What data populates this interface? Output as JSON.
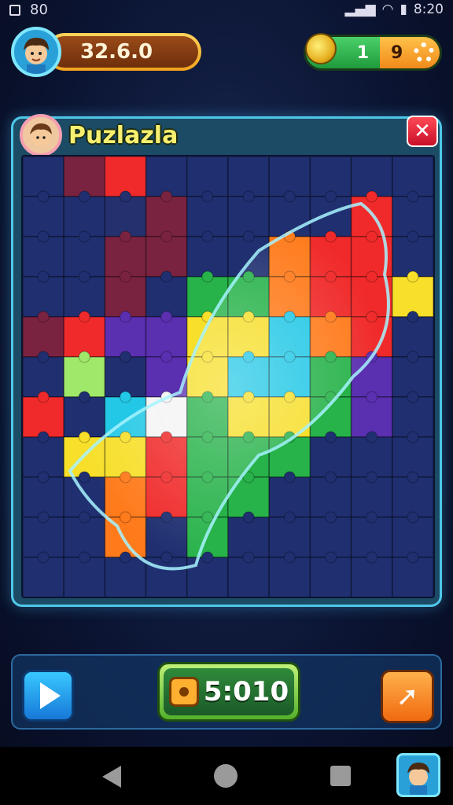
{
  "status_bar": {
    "left_text": "80",
    "time": "8:20"
  },
  "hud": {
    "score": "32.6.0",
    "coins": "1",
    "gems": "9"
  },
  "panel": {
    "title": "Puzlazla",
    "close_glyph": "✕"
  },
  "footer": {
    "timer": "5:010"
  },
  "colors": {
    "accent": "#4fc7e8",
    "title_yellow": "#f8f070",
    "close_red": "#e0202e"
  },
  "icons": [
    "avatar-icon",
    "coin-icon",
    "gear-icon",
    "close-icon",
    "play-icon",
    "puzzle-icon",
    "share-icon",
    "back-icon",
    "home-icon",
    "recent-icon"
  ]
}
